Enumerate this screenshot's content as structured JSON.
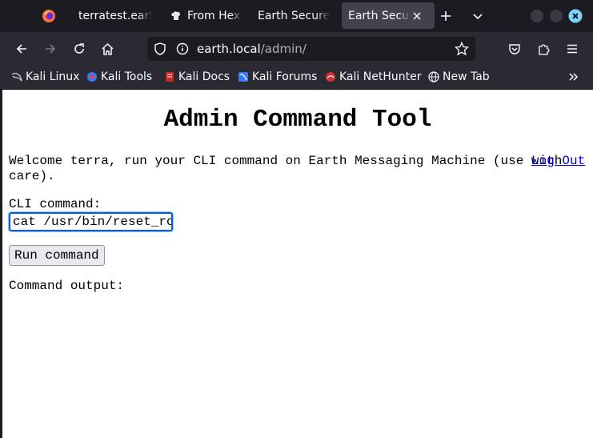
{
  "tabs": [
    {
      "title": "terratest.earth",
      "icon": "hexagon-icon"
    },
    {
      "title": "From Hex,",
      "icon": "chef-icon"
    },
    {
      "title": "Earth Secure M",
      "icon": ""
    },
    {
      "title": "Earth Secure",
      "icon": ""
    }
  ],
  "nav": {
    "url_host": "earth.local",
    "url_path": "/admin/"
  },
  "bookmarks": [
    "Kali Linux",
    "Kali Tools",
    "Kali Docs",
    "Kali Forums",
    "Kali NetHunter",
    "New Tab"
  ],
  "page": {
    "title": "Admin Command Tool",
    "welcome": "Welcome terra, run your CLI command on Earth Messaging Machine (use with care).",
    "logout": "Log Out",
    "cli_label": "CLI command:",
    "cli_value": "cat /usr/bin/reset_root",
    "run_button": "Run command",
    "output_label": "Command output:"
  },
  "colors": {
    "accent": "#0060df",
    "link": "#0000ee",
    "chrome_dark": "#1c1b22",
    "chrome": "#2b2a33"
  }
}
